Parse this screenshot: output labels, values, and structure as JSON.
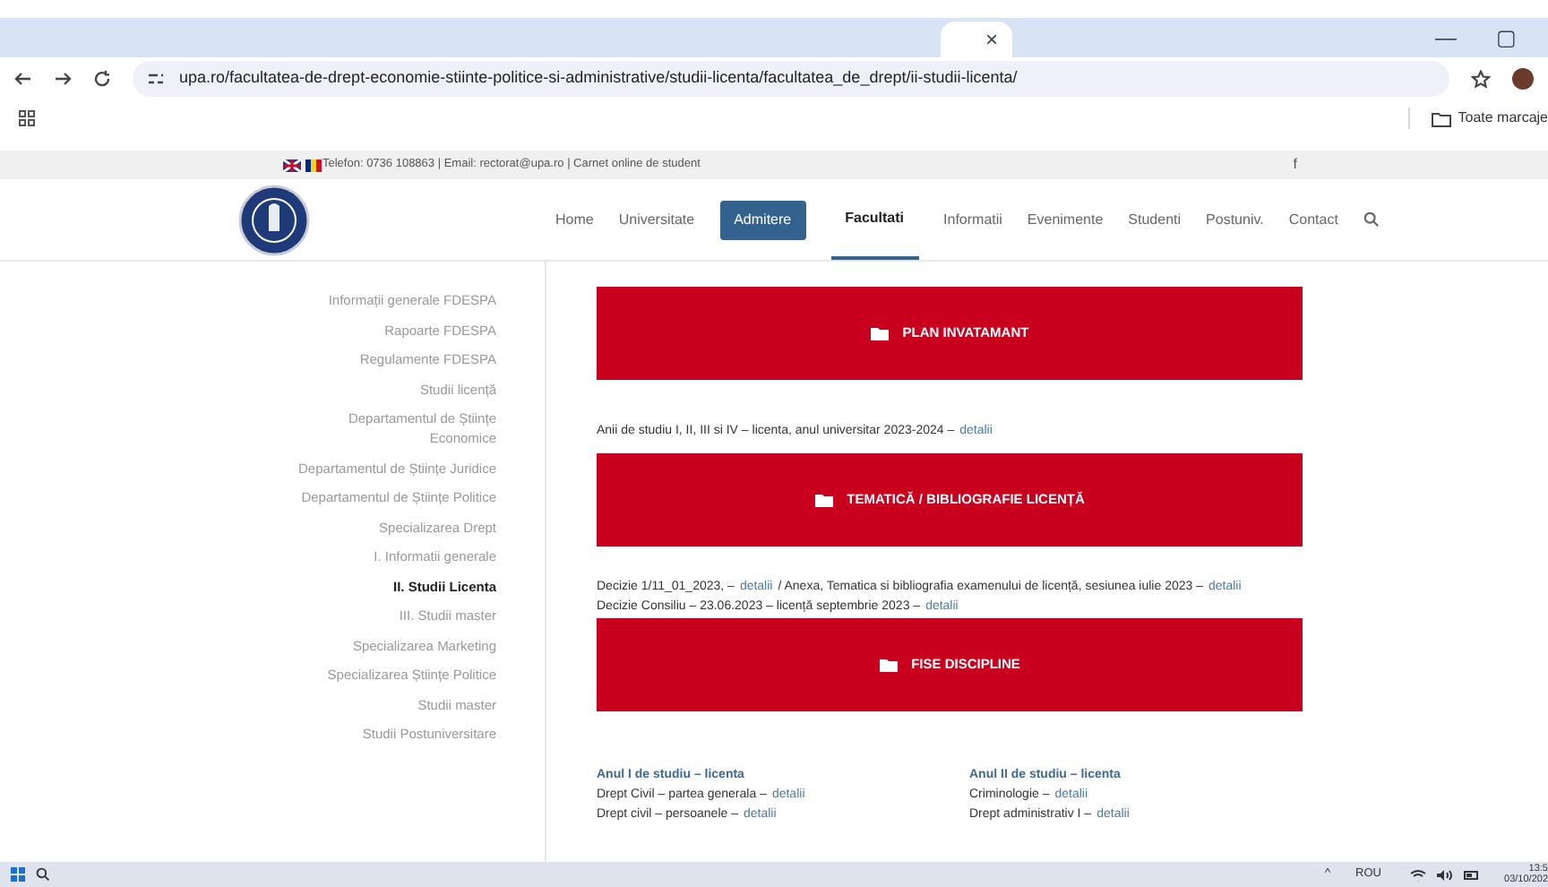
{
  "browser": {
    "tab_close": "×",
    "window_controls": [
      "—",
      "▢"
    ],
    "url": "upa.ro/facultatea-de-drept-economie-stiinte-politice-si-administrative/studii-licenta/facultatea_de_drept/ii-studii-licenta/",
    "bookmarks_label": "Toate marcaje"
  },
  "topbar": {
    "contact": "Telefon: 0736 108863 | Email: rectorat@upa.ro | Carnet online de student",
    "social": "f"
  },
  "nav": [
    {
      "label": "Home",
      "kind": "plain"
    },
    {
      "label": "Universitate",
      "kind": "plain"
    },
    {
      "label": "Admitere",
      "kind": "highlight"
    },
    {
      "label": "Facultati",
      "kind": "current"
    },
    {
      "label": "Informatii",
      "kind": "plain"
    },
    {
      "label": "Evenimente",
      "kind": "plain"
    },
    {
      "label": "Studenti",
      "kind": "plain"
    },
    {
      "label": "Postuniv.",
      "kind": "plain"
    },
    {
      "label": "Contact",
      "kind": "plain"
    }
  ],
  "sidebar": [
    {
      "label": "Informații generale FDESPA",
      "selected": false
    },
    {
      "label": "Rapoarte FDESPA",
      "selected": false
    },
    {
      "label": "Regulamente FDESPA",
      "selected": false
    },
    {
      "label": "Studii licență",
      "selected": false
    },
    {
      "label": "Departamentul de Științe Economice",
      "selected": false
    },
    {
      "label": "Departamentul de Științe Juridice",
      "selected": false
    },
    {
      "label": "Departamentul de Științe Politice",
      "selected": false
    },
    {
      "label": "Specializarea Drept",
      "selected": false
    },
    {
      "label": "I. Informatii generale",
      "selected": false
    },
    {
      "label": "II. Studii Licenta",
      "selected": true
    },
    {
      "label": "III. Studii master",
      "selected": false
    },
    {
      "label": "Specializarea Marketing",
      "selected": false
    },
    {
      "label": "Specializarea Științe Politice",
      "selected": false
    },
    {
      "label": "Studii master",
      "selected": false
    },
    {
      "label": "Studii Postuniversitare",
      "selected": false
    }
  ],
  "sections": [
    {
      "button": "PLAN INVATAMANT",
      "lines": [
        [
          {
            "text": "Anii de studiu I, II, III si IV – licenta, anul universitar 2023-2024 –",
            "kind": "text"
          },
          {
            "text": "detalii",
            "kind": "link"
          }
        ]
      ]
    },
    {
      "button": "TEMATICĂ / BIBLIOGRAFIE LICENȚĂ",
      "lines": [
        [
          {
            "text": "Decizie 1/11_01_2023, –",
            "kind": "text"
          },
          {
            "text": "detalii",
            "kind": "link"
          },
          {
            "text": "/ Anexa, Tematica si bibliografia examenului de licență, sesiunea iulie 2023  –",
            "kind": "text"
          },
          {
            "text": "detalii",
            "kind": "link"
          }
        ],
        [
          {
            "text": "Decizie Consiliu – 23.06.2023 – licență septembrie 2023 –",
            "kind": "text"
          },
          {
            "text": "detalii",
            "kind": "link"
          }
        ]
      ]
    },
    {
      "button": "FISE DISCIPLINE"
    }
  ],
  "years": [
    {
      "heading": "Anul I de studiu – licenta",
      "lines": [
        [
          {
            "text": "Drept Civil – partea generala –",
            "kind": "text"
          },
          {
            "text": "detalii",
            "kind": "link"
          }
        ],
        [
          {
            "text": "Drept civil – persoanele –",
            "kind": "text"
          },
          {
            "text": "detalii",
            "kind": "link"
          }
        ]
      ]
    },
    {
      "heading": "Anul II de studiu – licenta",
      "lines": [
        [
          {
            "text": "Criminologie –",
            "kind": "text"
          },
          {
            "text": "detalii",
            "kind": "link"
          }
        ],
        [
          {
            "text": "Drept administrativ I –",
            "kind": "text"
          },
          {
            "text": "detalii",
            "kind": "link"
          }
        ]
      ]
    }
  ],
  "taskbar": {
    "tray_caret": "^",
    "language": "ROU",
    "time": "13:5",
    "date": "03/10/202"
  }
}
